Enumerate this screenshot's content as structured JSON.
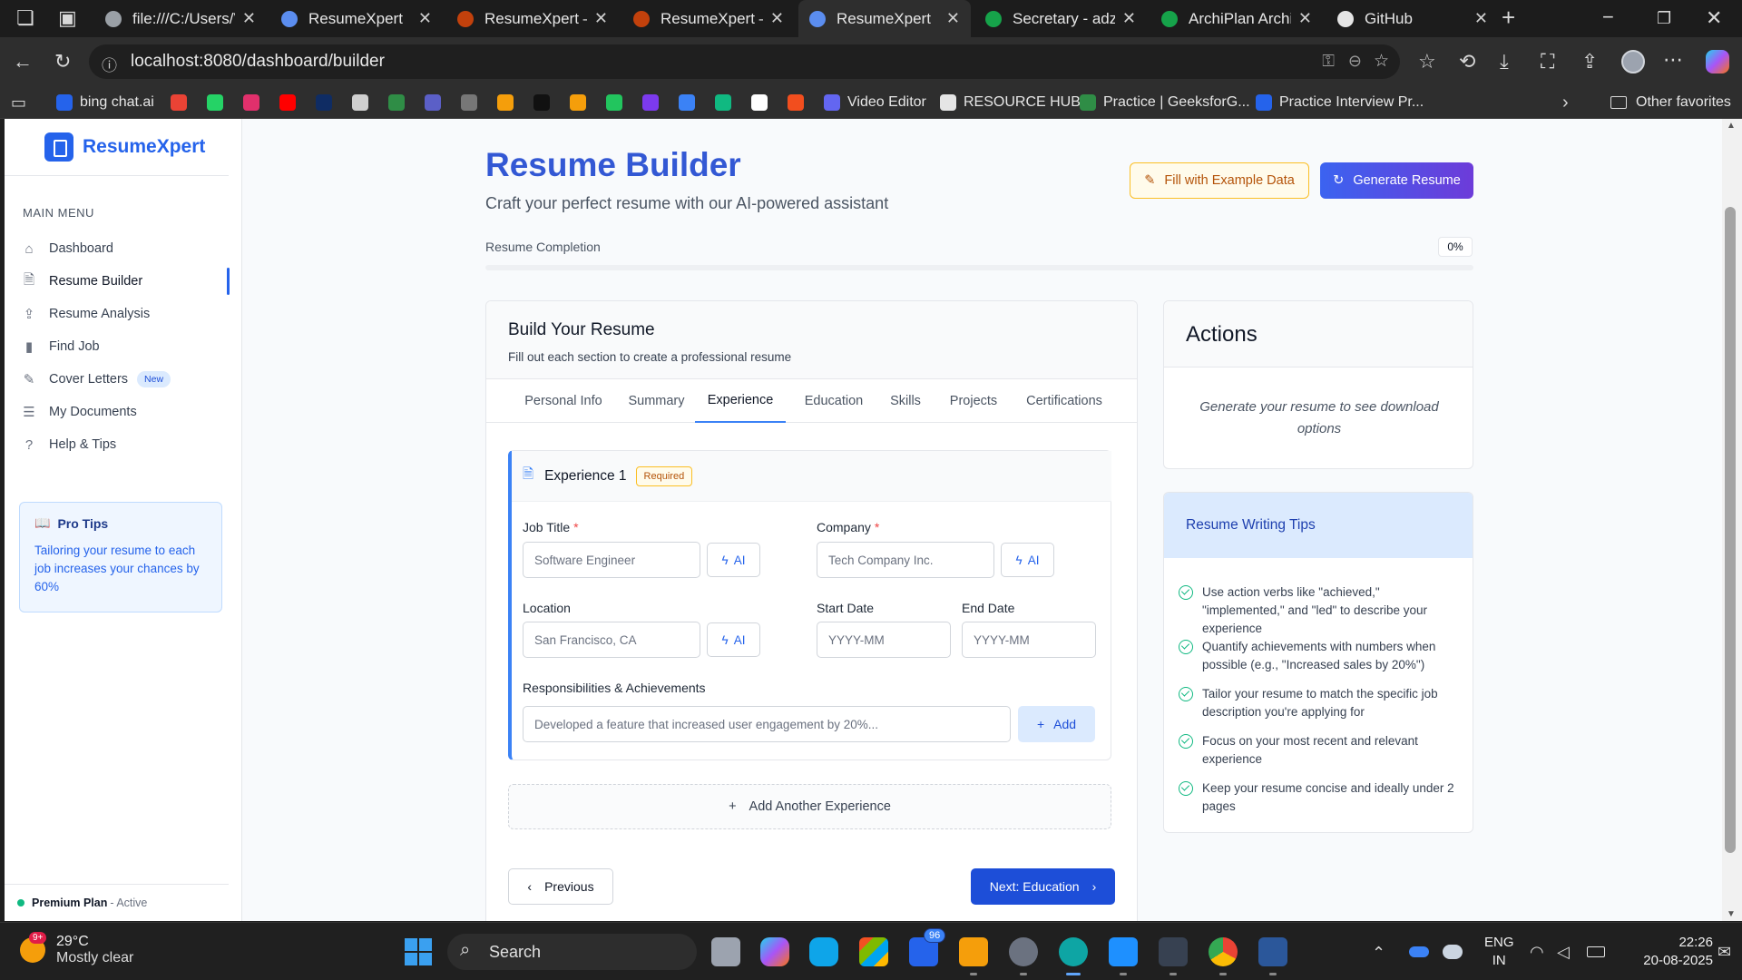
{
  "browser": {
    "tabs": [
      {
        "title": "file:///C:/Users/Vi",
        "color": "#9aa0a6"
      },
      {
        "title": "ResumeXpert",
        "color": "#5b8def"
      },
      {
        "title": "ResumeXpert – Cl",
        "color": "#c2410c"
      },
      {
        "title": "ResumeXpert – Cl",
        "color": "#c2410c"
      },
      {
        "title": "ResumeXpert",
        "color": "#5b8def"
      },
      {
        "title": "Secretary - adzun",
        "color": "#16a34a"
      },
      {
        "title": "ArchiPlan Architec",
        "color": "#16a34a"
      },
      {
        "title": "GitHub",
        "color": "#e5e5e5"
      }
    ],
    "url": "localhost:8080/dashboard/builder",
    "favorites": [
      {
        "label": "bing chat.ai",
        "color": "#2563eb"
      },
      {
        "label": "",
        "color": "#ea4335"
      },
      {
        "label": "",
        "color": "#25d366"
      },
      {
        "label": "",
        "color": "#e1306c"
      },
      {
        "label": "",
        "color": "#ff0000"
      },
      {
        "label": "",
        "color": "#0f2c63"
      },
      {
        "label": "",
        "color": "#cfcfcf"
      },
      {
        "label": "",
        "color": "#2f8d46"
      },
      {
        "label": "",
        "color": "#5b5fc7"
      },
      {
        "label": "",
        "color": "#777777"
      },
      {
        "label": "",
        "color": "#f59e0b"
      },
      {
        "label": "",
        "color": "#111111"
      },
      {
        "label": "",
        "color": "#f59e0b"
      },
      {
        "label": "",
        "color": "#22c55e"
      },
      {
        "label": "",
        "color": "#7c3aed"
      },
      {
        "label": "",
        "color": "#3b82f6"
      },
      {
        "label": "",
        "color": "#10b981"
      },
      {
        "label": "",
        "color": "#ffffff"
      },
      {
        "label": "",
        "color": "#f24e1e"
      },
      {
        "label": "Video Editor",
        "color": "#6366f1"
      },
      {
        "label": "RESOURCE HUB",
        "color": "#e5e5e5"
      },
      {
        "label": "Practice | GeeksforG...",
        "color": "#2f8d46"
      },
      {
        "label": "Practice Interview Pr...",
        "color": "#2563eb"
      }
    ],
    "other_favorites": "Other favorites"
  },
  "sidebar": {
    "brand": "ResumeXpert",
    "menu_title": "MAIN MENU",
    "items": [
      {
        "label": "Dashboard",
        "icon": "home-icon"
      },
      {
        "label": "Resume Builder",
        "icon": "document-icon"
      },
      {
        "label": "Resume Analysis",
        "icon": "upload-icon"
      },
      {
        "label": "Find Job",
        "icon": "bar-chart-icon"
      },
      {
        "label": "Cover Letters",
        "icon": "edit-icon",
        "badge": "New"
      },
      {
        "label": "My Documents",
        "icon": "list-icon"
      },
      {
        "label": "Help & Tips",
        "icon": "help-icon"
      }
    ],
    "active_index": 1,
    "pro_tips": {
      "title": "Pro Tips",
      "text": "Tailoring your resume to each job increases your chances by 60%"
    },
    "plan": {
      "name": "Premium Plan",
      "status": "- Active"
    }
  },
  "header": {
    "title": "Resume Builder",
    "subtitle": "Craft your perfect resume with our AI-powered assistant",
    "fill_button": "Fill with Example Data",
    "generate_button": "Generate Resume",
    "completion_label": "Resume Completion",
    "completion_value": "0%",
    "completion_fraction": 0
  },
  "builder": {
    "title": "Build Your Resume",
    "subtitle": "Fill out each section to create a professional resume",
    "tabs": [
      "Personal Info",
      "Summary",
      "Experience",
      "Education",
      "Skills",
      "Projects",
      "Certifications"
    ],
    "active_tab": 2,
    "experience": {
      "title": "Experience 1",
      "badge": "Required",
      "job_title_label": "Job Title",
      "job_title_placeholder": "Software Engineer",
      "company_label": "Company",
      "company_placeholder": "Tech Company Inc.",
      "location_label": "Location",
      "location_placeholder": "San Francisco, CA",
      "start_label": "Start Date",
      "start_placeholder": "YYYY-MM",
      "end_label": "End Date",
      "end_placeholder": "YYYY-MM",
      "resp_label": "Responsibilities & Achievements",
      "resp_placeholder": "Developed a feature that increased user engagement by 20%...",
      "ai_label": "AI",
      "add_label": "Add"
    },
    "add_another": "Add Another Experience",
    "prev": "Previous",
    "next": "Next: Education"
  },
  "actions": {
    "title": "Actions",
    "note": "Generate your resume to see download options"
  },
  "tips": {
    "title": "Resume Writing Tips",
    "items": [
      "Use action verbs like \"achieved,\" \"implemented,\" and \"led\" to describe your experience",
      "Quantify achievements with numbers when possible (e.g., \"Increased sales by 20%\")",
      "Tailor your resume to match the specific job description you're applying for",
      "Focus on your most recent and relevant experience",
      "Keep your resume concise and ideally under 2 pages"
    ]
  },
  "taskbar": {
    "weather_temp": "29°C",
    "weather_desc": "Mostly clear",
    "weather_alert": "9+",
    "search": "Search",
    "lang1": "ENG",
    "lang2": "IN",
    "time": "22:26",
    "date": "20-08-2025",
    "mail_badge": "96"
  }
}
